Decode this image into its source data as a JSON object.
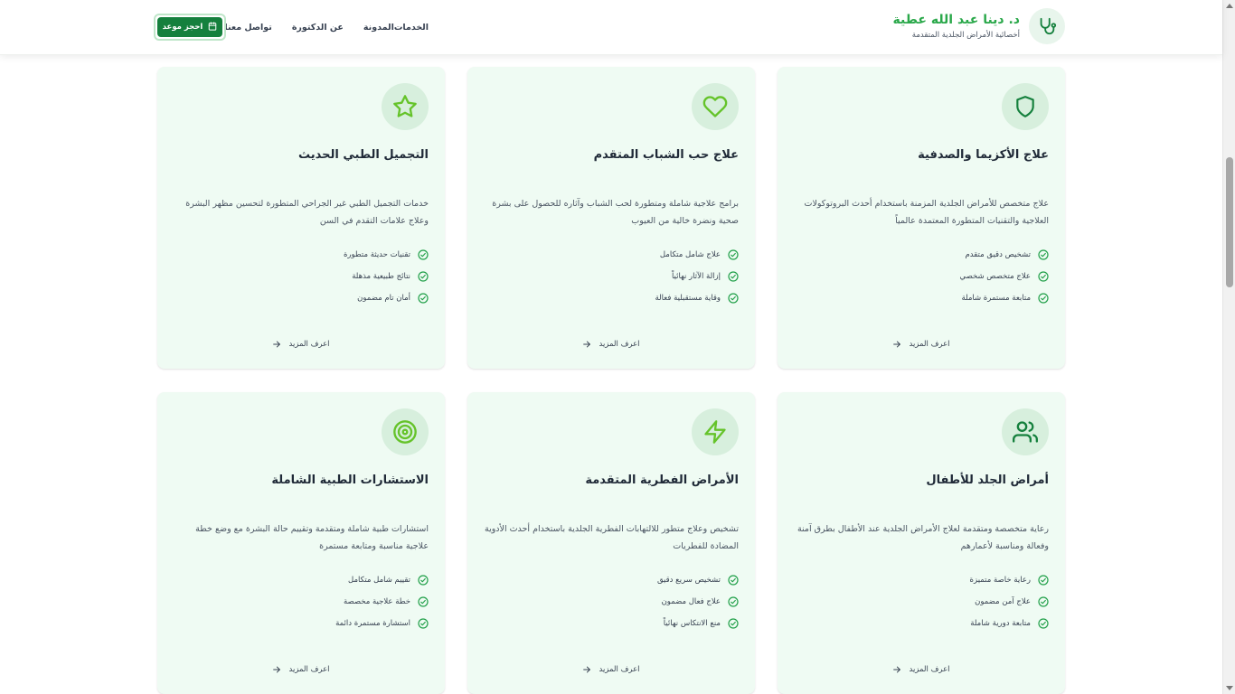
{
  "header": {
    "logo_name": "د. دينا عبد الله عطية",
    "logo_subtitle": "أخصائية الأمراض الجلدية المتقدمة",
    "logo_icon": "stethoscope-icon",
    "nav": [
      "الخدمات",
      "المدونة",
      "عن الدكتورة",
      "تواصل معنا"
    ],
    "book_label": "احجز موعد",
    "book_icon": "calendar-icon"
  },
  "colors": {
    "brand_green": "#2aa84a",
    "button_green": "#15803d",
    "card_bg": "#effbf3",
    "icon_bg": "#d7efdd"
  },
  "more_label": "اعرف المزيد",
  "services": [
    {
      "icon": "shield-icon",
      "title": "علاج الأكزيما والصدفية",
      "description": "علاج متخصص للأمراض الجلدية المزمنة باستخدام أحدث البروتوكولات العلاجية والتقنيات المتطورة المعتمدة عالمياً",
      "features": [
        "تشخيص دقيق متقدم",
        "علاج متخصص شخصي",
        "متابعة مستمرة شاملة"
      ]
    },
    {
      "icon": "heart-icon",
      "title": "علاج حب الشباب المتقدم",
      "description": "برامج علاجية شاملة ومتطورة لحب الشباب وآثاره للحصول على بشرة صحية ونضرة خالية من العيوب",
      "features": [
        "علاج شامل متكامل",
        "إزالة الآثار نهائياً",
        "وقاية مستقبلية فعالة"
      ]
    },
    {
      "icon": "star-icon",
      "title": "التجميل الطبي الحديث",
      "description": "خدمات التجميل الطبي غير الجراحي المتطورة لتحسين مظهر البشرة وعلاج علامات التقدم في السن",
      "features": [
        "تقنيات حديثة متطورة",
        "نتائج طبيعية مذهلة",
        "أمان تام مضمون"
      ]
    },
    {
      "icon": "users-icon",
      "title": "أمراض الجلد للأطفال",
      "description": "رعاية متخصصة ومتقدمة لعلاج الأمراض الجلدية عند الأطفال بطرق آمنة وفعالة ومناسبة لأعمارهم",
      "features": [
        "رعاية خاصة متميزة",
        "علاج آمن مضمون",
        "متابعة دورية شاملة"
      ]
    },
    {
      "icon": "lightning-icon",
      "title": "الأمراض الفطرية المتقدمة",
      "description": "تشخيص وعلاج متطور للالتهابات الفطرية الجلدية باستخدام أحدث الأدوية المضادة للفطريات",
      "features": [
        "تشخيص سريع دقيق",
        "علاج فعال مضمون",
        "منع الانتكاس نهائياً"
      ]
    },
    {
      "icon": "target-icon",
      "title": "الاستشارات الطبية الشاملة",
      "description": "استشارات طبية شاملة ومتقدمة وتقييم حالة البشرة مع وضع خطة علاجية مناسبة ومتابعة مستمرة",
      "features": [
        "تقييم شامل متكامل",
        "خطة علاجية مخصصة",
        "استشارة مستمرة دائمة"
      ]
    }
  ]
}
